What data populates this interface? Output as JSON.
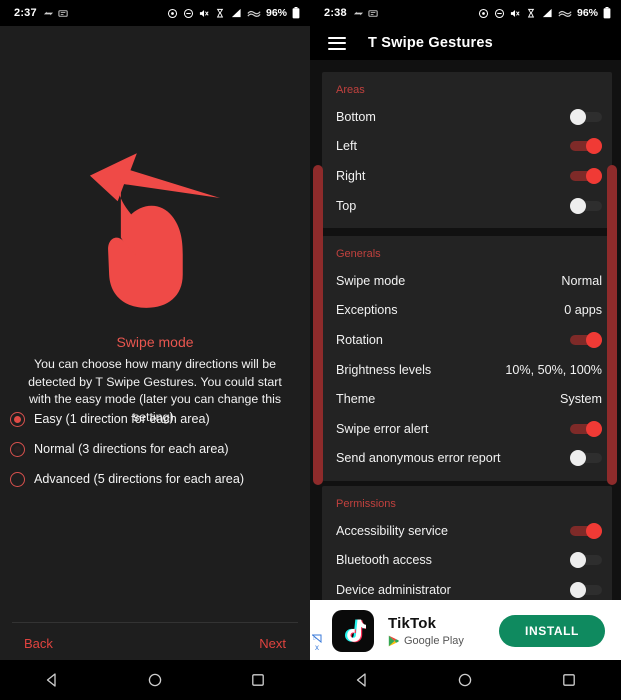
{
  "colors": {
    "accent_red": "#e53935",
    "section_header_red": "#c0413e",
    "card_bg": "#232323",
    "page_bg": "#111111",
    "install_green": "#0f8a5f"
  },
  "left_phone": {
    "status_bar": {
      "time": "2:37",
      "battery": "96%"
    },
    "title": "Swipe mode",
    "description": "You can choose how many directions will be detected by T Swipe Gestures. You could start with the easy mode (later you can change this setting).",
    "options": [
      {
        "label": "Easy (1 direction for each area)",
        "selected": true
      },
      {
        "label": "Normal (3 directions for each area)",
        "selected": false
      },
      {
        "label": "Advanced (5 directions for each area)",
        "selected": false
      }
    ],
    "back_label": "Back",
    "next_label": "Next"
  },
  "right_phone": {
    "status_bar": {
      "time": "2:38",
      "battery": "96%"
    },
    "app_bar": {
      "title": "T Swipe Gestures"
    },
    "sections": {
      "areas": {
        "title": "Areas",
        "rows": [
          {
            "label": "Bottom",
            "toggle": "off"
          },
          {
            "label": "Left",
            "toggle": "on"
          },
          {
            "label": "Right",
            "toggle": "on"
          },
          {
            "label": "Top",
            "toggle": "off"
          }
        ]
      },
      "generals": {
        "title": "Generals",
        "rows": [
          {
            "label": "Swipe mode",
            "value": "Normal"
          },
          {
            "label": "Exceptions",
            "value": "0 apps"
          },
          {
            "label": "Rotation",
            "toggle": "on"
          },
          {
            "label": "Brightness levels",
            "value": "10%, 50%, 100%"
          },
          {
            "label": "Theme",
            "value": "System"
          },
          {
            "label": "Swipe error alert",
            "toggle": "on"
          },
          {
            "label": "Send anonymous error report",
            "toggle": "off"
          }
        ]
      },
      "permissions": {
        "title": "Permissions",
        "rows": [
          {
            "label": "Accessibility service",
            "toggle": "on"
          },
          {
            "label": "Bluetooth access",
            "toggle": "off"
          },
          {
            "label": "Device administrator",
            "toggle": "off"
          }
        ]
      }
    },
    "ad": {
      "title": "TikTok",
      "source": "Google Play",
      "cta": "INSTALL",
      "adchoices": "x"
    }
  }
}
